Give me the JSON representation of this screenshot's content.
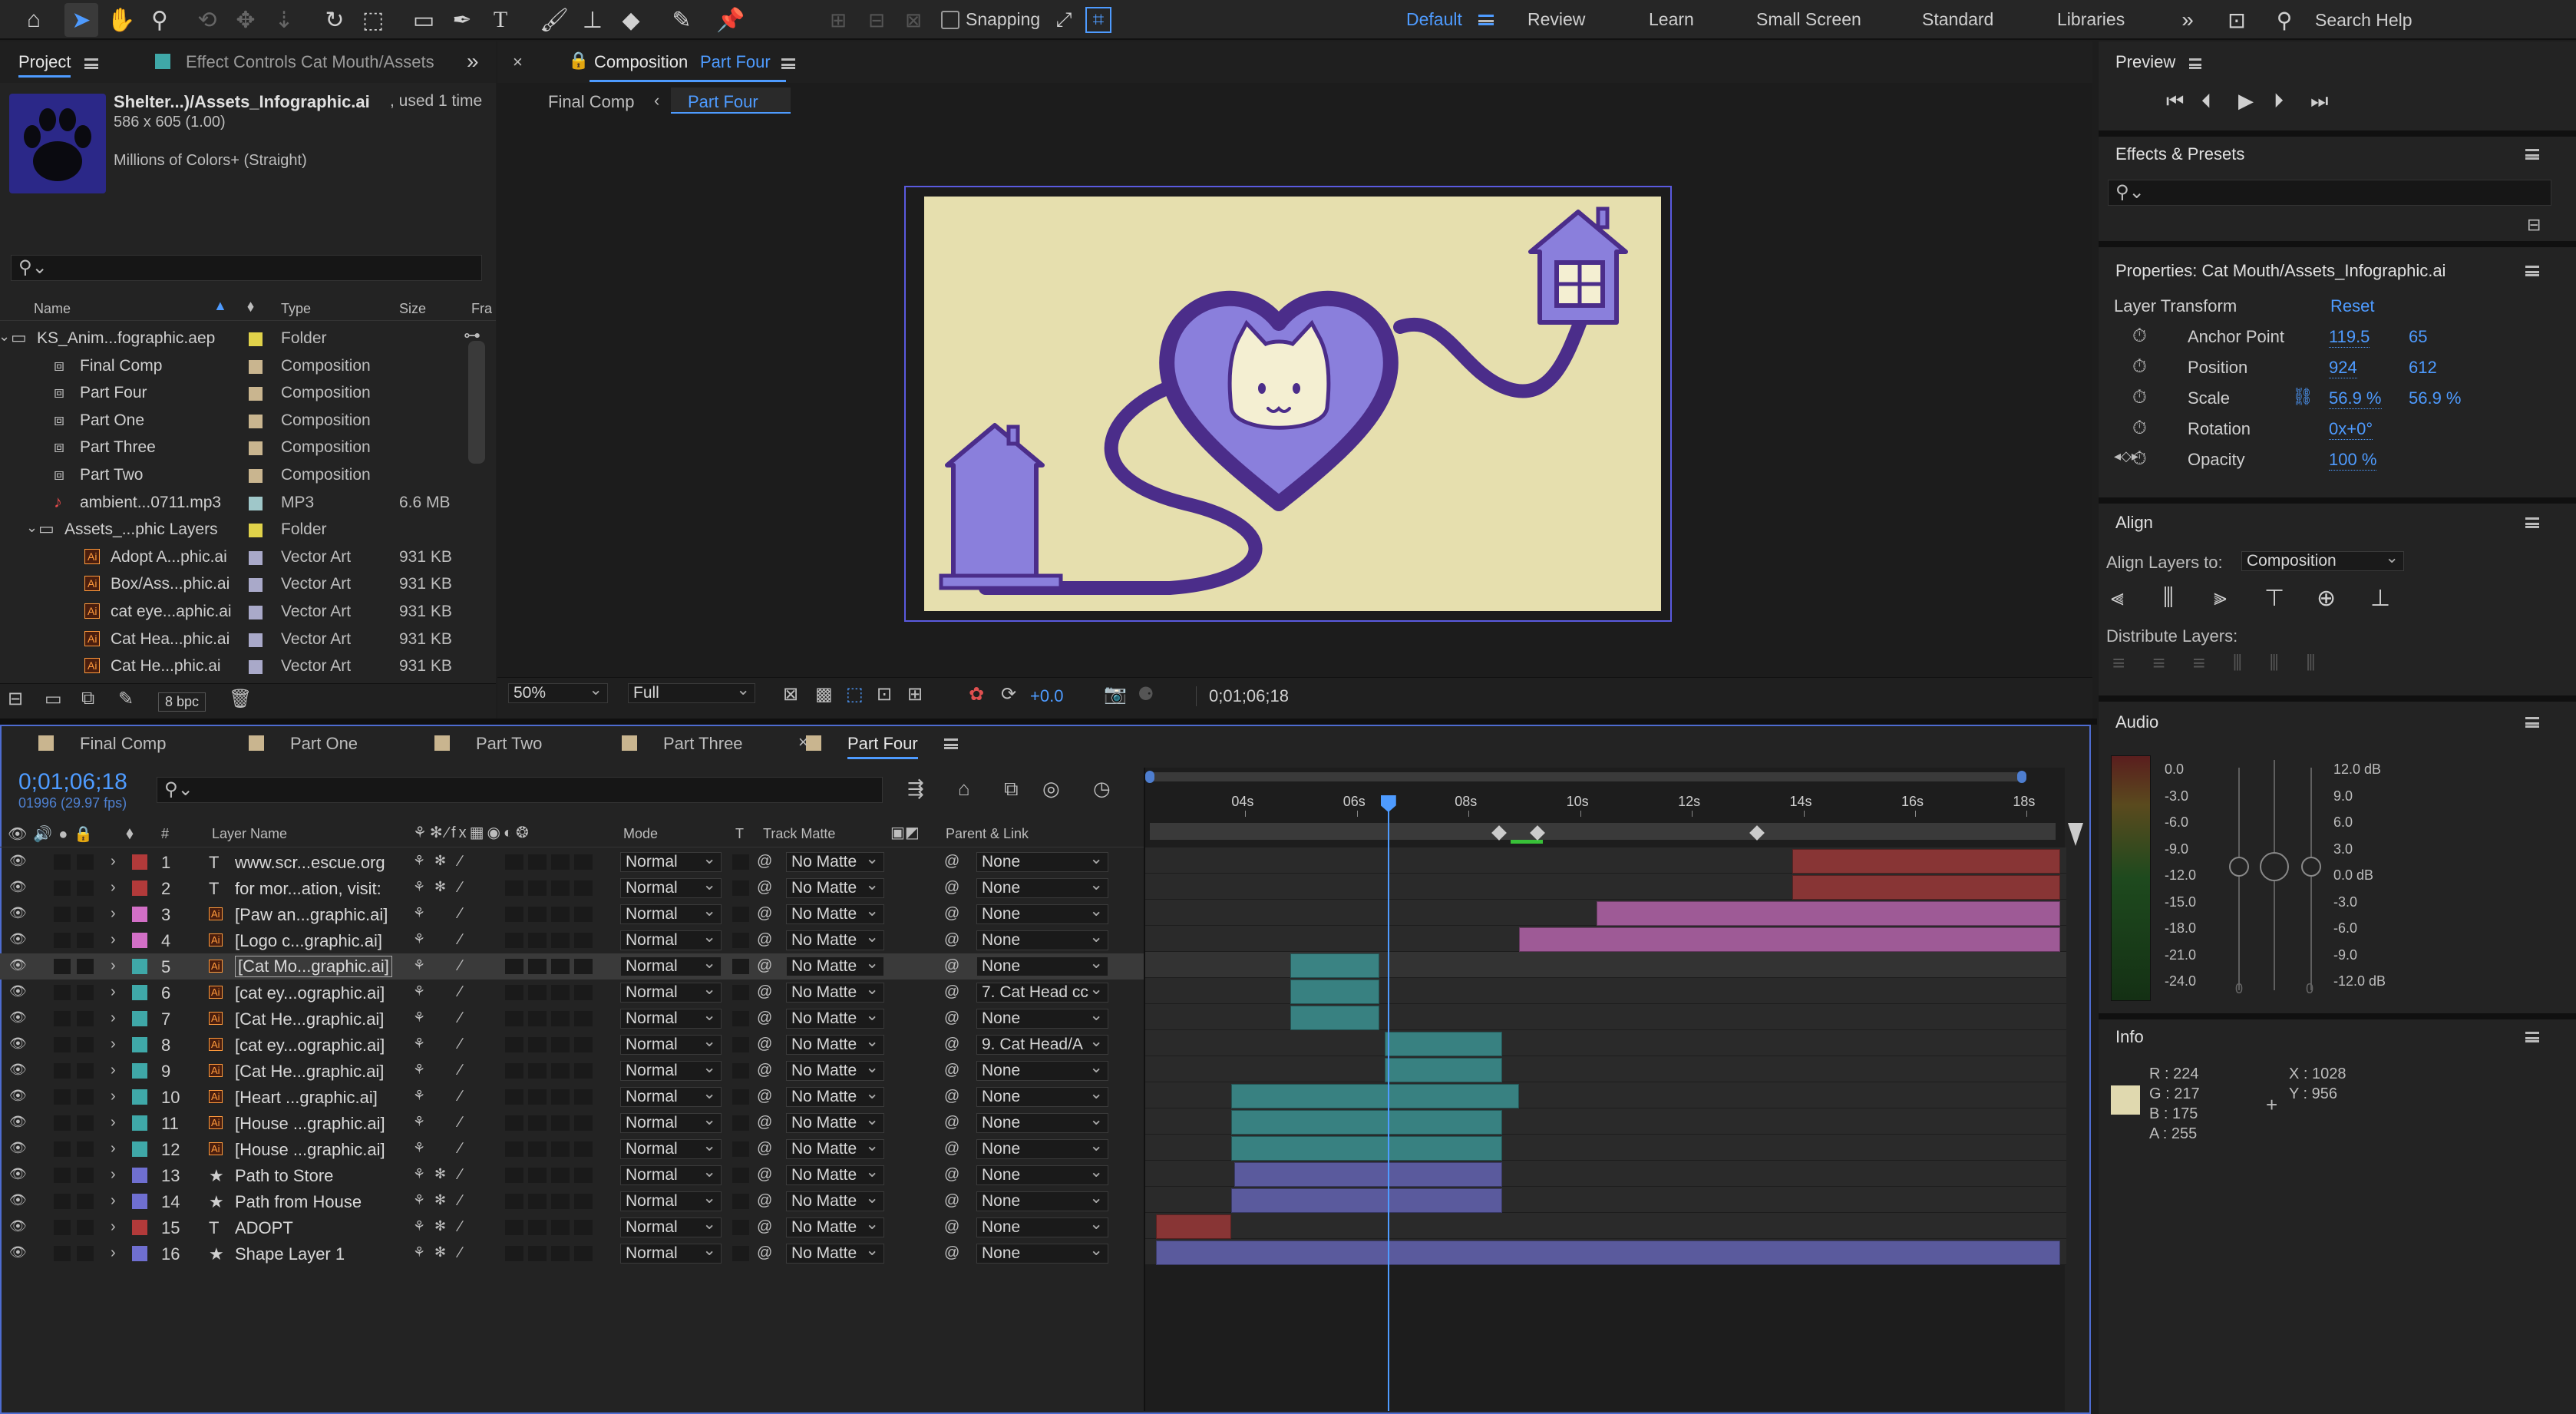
{
  "toolbar": {
    "snapping_label": "Snapping",
    "search_placeholder": "Search Help",
    "workspaces": [
      "Default",
      "Review",
      "Learn",
      "Small Screen",
      "Standard",
      "Libraries"
    ]
  },
  "project": {
    "tab": "Project",
    "effect_controls_tab": "Effect Controls Cat Mouth/Assets",
    "asset_name": "Shelter...)/Assets_Infographic.ai",
    "asset_used": ", used 1 time",
    "asset_dims": "586 x 605 (1.00)",
    "asset_colors": "Millions of Colors+ (Straight)",
    "bpc": "8 bpc",
    "columns": {
      "name": "Name",
      "type": "Type",
      "size": "Size",
      "frame": "Fra"
    },
    "items": [
      {
        "name": "KS_Anim...fographic.aep",
        "type": "Folder",
        "size": "",
        "color": "#e0d24a"
      },
      {
        "name": "Final Comp",
        "type": "Composition",
        "size": "",
        "color": "#c9b58f"
      },
      {
        "name": "Part Four",
        "type": "Composition",
        "size": "",
        "color": "#c9b58f"
      },
      {
        "name": "Part One",
        "type": "Composition",
        "size": "",
        "color": "#c9b58f"
      },
      {
        "name": "Part Three",
        "type": "Composition",
        "size": "",
        "color": "#c9b58f"
      },
      {
        "name": "Part Two",
        "type": "Composition",
        "size": "",
        "color": "#c9b58f"
      },
      {
        "name": "ambient...0711.mp3",
        "type": "MP3",
        "size": "6.6 MB",
        "color": "#9fc7c9"
      },
      {
        "name": "Assets_...phic Layers",
        "type": "Folder",
        "size": "",
        "color": "#e0d24a"
      },
      {
        "name": "Adopt A...phic.ai",
        "type": "Vector Art",
        "size": "931 KB",
        "color": "#a9a9c9"
      },
      {
        "name": "Box/Ass...phic.ai",
        "type": "Vector Art",
        "size": "931 KB",
        "color": "#a9a9c9"
      },
      {
        "name": "cat eye...aphic.ai",
        "type": "Vector Art",
        "size": "931 KB",
        "color": "#a9a9c9"
      },
      {
        "name": "Cat Hea...phic.ai",
        "type": "Vector Art",
        "size": "931 KB",
        "color": "#a9a9c9"
      },
      {
        "name": "Cat He...phic.ai",
        "type": "Vector Art",
        "size": "931 KB",
        "color": "#a9a9c9"
      }
    ]
  },
  "composition": {
    "label": "Composition",
    "name": "Part Four",
    "breadcrumbs": [
      "Final Comp",
      "Part Four"
    ],
    "zoom": "50%",
    "resolution": "Full",
    "exposure": "+0.0",
    "timecode": "0;01;06;18"
  },
  "preview": {
    "title": "Preview"
  },
  "effects": {
    "title": "Effects & Presets"
  },
  "properties": {
    "title": "Properties: Cat Mouth/Assets_Infographic.ai",
    "section": "Layer Transform",
    "reset": "Reset",
    "rows": [
      {
        "label": "Anchor Point",
        "v1": "119.5",
        "v2": "65"
      },
      {
        "label": "Position",
        "v1": "924",
        "v2": "612"
      },
      {
        "label": "Scale",
        "v1": "56.9 %",
        "v2": "56.9 %"
      },
      {
        "label": "Rotation",
        "v1": "0x+0°",
        "v2": ""
      },
      {
        "label": "Opacity",
        "v1": "100 %",
        "v2": ""
      }
    ]
  },
  "align": {
    "title": "Align",
    "align_to_label": "Align Layers to:",
    "align_to_value": "Composition",
    "distribute_label": "Distribute Layers:"
  },
  "audio": {
    "title": "Audio",
    "left_scale": [
      "0.0",
      "-3.0",
      "-6.0",
      "-9.0",
      "-12.0",
      "-15.0",
      "-18.0",
      "-21.0",
      "-24.0"
    ],
    "right_scale": [
      "12.0 dB",
      "9.0",
      "6.0",
      "3.0",
      "0.0 dB",
      "-3.0",
      "-6.0",
      "-9.0",
      "-12.0 dB"
    ],
    "zero_a": "0",
    "zero_b": "0"
  },
  "info": {
    "title": "Info",
    "r": "R :  224",
    "g": "G :  217",
    "b": "B :  175",
    "a": "A :  255",
    "x": "X :  1028",
    "y": "Y :  956",
    "swatch": "#e0d9af"
  },
  "timeline": {
    "tabs": [
      "Final Comp",
      "Part One",
      "Part Two",
      "Part Three",
      "Part Four"
    ],
    "timecode": "0;01;06;18",
    "frames": "01996 (29.97 fps)",
    "columns": {
      "num": "#",
      "layer_name": "Layer Name",
      "mode": "Mode",
      "t": "T",
      "track_matte": "Track Matte",
      "parent": "Parent & Link"
    },
    "ruler": [
      "04s",
      "06s",
      "08s",
      "10s",
      "12s",
      "14s",
      "16s",
      "18s"
    ],
    "layers": [
      {
        "num": "1",
        "icon": "T",
        "name": "www.scr...escue.org",
        "mode": "Normal",
        "matte": "No Matte",
        "parent": "None",
        "color": "#b23a3a",
        "start": 13.8,
        "end": 18.6
      },
      {
        "num": "2",
        "icon": "T",
        "name": "for mor...ation, visit:",
        "mode": "Normal",
        "matte": "No Matte",
        "parent": "None",
        "color": "#b23a3a",
        "start": 13.8,
        "end": 18.6
      },
      {
        "num": "3",
        "icon": "ai",
        "name": "[Paw an...graphic.ai]",
        "mode": "Normal",
        "matte": "No Matte",
        "parent": "None",
        "color": "#d26fc6",
        "start": 10.3,
        "end": 18.6
      },
      {
        "num": "4",
        "icon": "ai",
        "name": "[Logo c...graphic.ai]",
        "mode": "Normal",
        "matte": "No Matte",
        "parent": "None",
        "color": "#d26fc6",
        "start": 8.9,
        "end": 18.6
      },
      {
        "num": "5",
        "icon": "ai",
        "name": "[Cat Mo...graphic.ai]",
        "mode": "Normal",
        "matte": "No Matte",
        "parent": "None",
        "color": "#3fa8a8",
        "start": 4.8,
        "end": 6.4,
        "selected": true
      },
      {
        "num": "6",
        "icon": "ai",
        "name": "[cat ey...ographic.ai]",
        "mode": "Normal",
        "matte": "No Matte",
        "parent": "7. Cat Head cc",
        "color": "#3fa8a8",
        "start": 4.8,
        "end": 6.4
      },
      {
        "num": "7",
        "icon": "ai",
        "name": "[Cat He...graphic.ai]",
        "mode": "Normal",
        "matte": "No Matte",
        "parent": "None",
        "color": "#3fa8a8",
        "start": 4.8,
        "end": 6.4
      },
      {
        "num": "8",
        "icon": "ai",
        "name": "[cat ey...ographic.ai]",
        "mode": "Normal",
        "matte": "No Matte",
        "parent": "9. Cat Head/A",
        "color": "#3fa8a8",
        "start": 6.5,
        "end": 8.6
      },
      {
        "num": "9",
        "icon": "ai",
        "name": "[Cat He...graphic.ai]",
        "mode": "Normal",
        "matte": "No Matte",
        "parent": "None",
        "color": "#3fa8a8",
        "start": 6.5,
        "end": 8.6
      },
      {
        "num": "10",
        "icon": "ai",
        "name": "[Heart ...graphic.ai]",
        "mode": "Normal",
        "matte": "No Matte",
        "parent": "None",
        "color": "#3fa8a8",
        "start": 3.75,
        "end": 8.9
      },
      {
        "num": "11",
        "icon": "ai",
        "name": "[House ...graphic.ai]",
        "mode": "Normal",
        "matte": "No Matte",
        "parent": "None",
        "color": "#3fa8a8",
        "start": 3.75,
        "end": 8.6
      },
      {
        "num": "12",
        "icon": "ai",
        "name": "[House ...graphic.ai]",
        "mode": "Normal",
        "matte": "No Matte",
        "parent": "None",
        "color": "#3fa8a8",
        "start": 3.75,
        "end": 8.6
      },
      {
        "num": "13",
        "icon": "star",
        "name": "Path to Store",
        "mode": "Normal",
        "matte": "No Matte",
        "parent": "None",
        "color": "#6f6fd0",
        "start": 3.8,
        "end": 8.6
      },
      {
        "num": "14",
        "icon": "star",
        "name": "Path from House",
        "mode": "Normal",
        "matte": "No Matte",
        "parent": "None",
        "color": "#6f6fd0",
        "start": 3.75,
        "end": 8.6
      },
      {
        "num": "15",
        "icon": "T",
        "name": "ADOPT",
        "mode": "Normal",
        "matte": "No Matte",
        "parent": "None",
        "color": "#b23a3a",
        "start": 2.4,
        "end": 3.75
      },
      {
        "num": "16",
        "icon": "star",
        "name": "Shape Layer 1",
        "mode": "Normal",
        "matte": "No Matte",
        "parent": "None",
        "color": "#6f6fd0",
        "start": 2.4,
        "end": 18.6
      }
    ]
  }
}
